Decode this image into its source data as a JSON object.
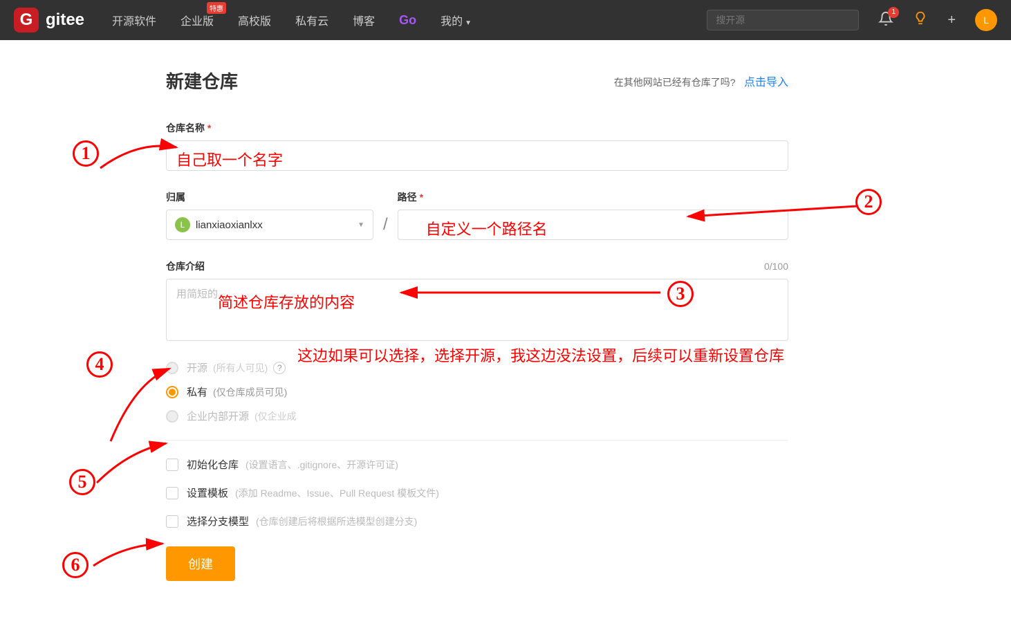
{
  "nav": {
    "logo_text": "gitee",
    "items": [
      "开源软件",
      "企业版",
      "高校版",
      "私有云",
      "博客"
    ],
    "enterprise_badge": "特惠",
    "go_label": "Go",
    "my_label": "我的",
    "search_placeholder": "搜开源",
    "bell_count": "1",
    "avatar_letter": "L"
  },
  "header": {
    "title": "新建仓库",
    "import_hint": "在其他网站已经有仓库了吗?",
    "import_link": "点击导入"
  },
  "fields": {
    "name_label": "仓库名称",
    "name_value_anno": "自己取一个名字",
    "owner_label": "归属",
    "owner_value": "lianxiaoxianlxx",
    "owner_avatar_letter": "L",
    "path_label": "路径",
    "path_value_anno": "自定义一个路径名",
    "intro_label": "仓库介绍",
    "intro_counter": "0/100",
    "intro_placeholder": "用简短的",
    "intro_value_anno": "简述仓库存放的内容"
  },
  "visibility": {
    "open_label": "开源",
    "open_hint": "(所有人可见)",
    "private_label": "私有",
    "private_hint": "(仅仓库成员可见)",
    "internal_label": "企业内部开源",
    "internal_hint": "(仅企业成"
  },
  "checks": {
    "init_label": "初始化仓库",
    "init_hint": "(设置语言、.gitignore、开源许可证)",
    "template_label": "设置模板",
    "template_hint": "(添加 Readme、Issue、Pull Request 模板文件)",
    "branch_label": "选择分支模型",
    "branch_hint": "(仓库创建后将根据所选模型创建分支)"
  },
  "create_button": "创建",
  "annotations": {
    "n1": "1",
    "n2": "2",
    "n3": "3",
    "n4": "4",
    "n5": "5",
    "n6": "6",
    "visibility_note": "这边如果可以选择，选择开源，我这边没法设置，后续可以重新设置仓库"
  }
}
